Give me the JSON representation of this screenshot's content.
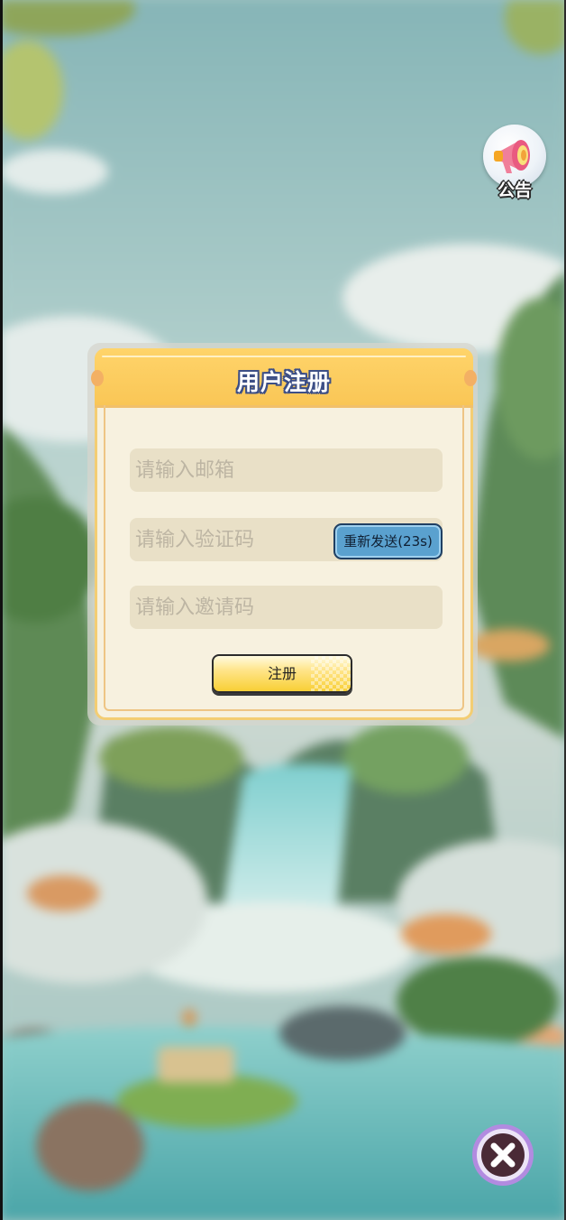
{
  "announcement": {
    "label": "公告",
    "icon": "megaphone-icon"
  },
  "dialog": {
    "title": "用户注册",
    "email_placeholder": "请输入邮箱",
    "code_placeholder": "请输入验证码",
    "invite_placeholder": "请输入邀请码",
    "resend_label": "重新发送(23s)",
    "submit_label": "注册"
  },
  "close": {
    "icon": "close-icon"
  },
  "colors": {
    "header": "#f9c656",
    "panel": "#f7f1df",
    "resend": "#5aa1cf",
    "submit": "#f8cf35",
    "close_ring": "#b28be0"
  }
}
